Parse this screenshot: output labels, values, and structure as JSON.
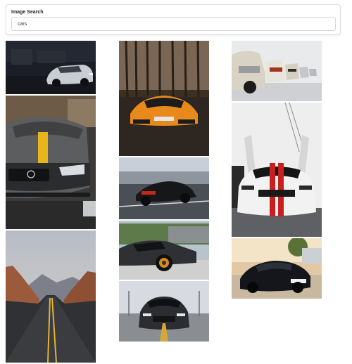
{
  "search": {
    "label": "Image Search",
    "value": "cars"
  },
  "results": {
    "columns": [
      [
        "night-camaro",
        "mercedes-amg-front",
        "desert-road"
      ],
      [
        "lamborghini-forest",
        "porsche-911-road",
        "mclaren-side",
        "mustang-front-highway"
      ],
      [
        "classic-cars-row",
        "mustang-gull-doors",
        "mustang-sunset"
      ]
    ]
  }
}
